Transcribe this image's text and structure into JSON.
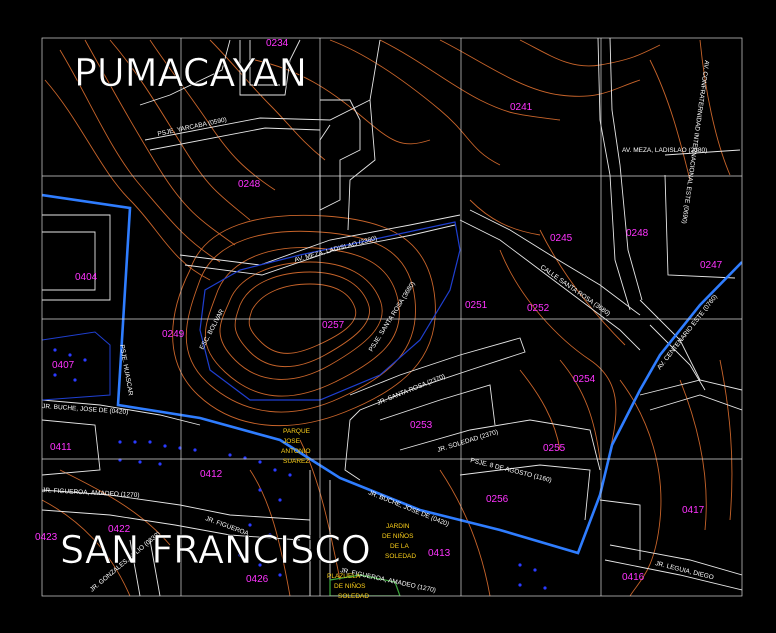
{
  "districts": {
    "north": "PUMACAYAN",
    "south": "SAN FRANCISCO"
  },
  "zones": {
    "z0234": "0234",
    "z0241": "0241",
    "z0248a": "0248",
    "z0245": "0245",
    "z0248b": "0248",
    "z0247": "0247",
    "z0404": "0404",
    "z0249": "0249",
    "z0257": "0257",
    "z0251": "0251",
    "z0252": "0252",
    "z0407": "0407",
    "z0254": "0254",
    "z0253": "0253",
    "z0411": "0411",
    "z0255": "0255",
    "z0412": "0412",
    "z0256": "0256",
    "z0417": "0417",
    "z0423": "0423",
    "z0422": "0422",
    "z0413": "0413",
    "z0426": "0426",
    "z0416": "0416"
  },
  "streets": {
    "yarcaba": "PSJE. YARCABA (0590)",
    "meza_ne": "AV. MEZA, LADISLAO (2380)",
    "confraternidad": "AV. CONFRATERNIDAD INTERNACIONAL ESTE (0690)",
    "meza_mid": "AV. MEZA, LADISLAO (2380)",
    "santa_rosa_a": "PSJE. SANTA ROSA (3680)",
    "santa_rosa_b": "JR. SANTA ROSA (2370)",
    "santa_rosa_c": "CALLE SANTA ROSA (3680)",
    "soledad": "JR. SOLEDAD (2370)",
    "ocho_agosto": "PSJE. 8 DE AGOSTO (1160)",
    "huaraz": "AV. CENTENARIO ESTE (0760)",
    "buche_w": "JR. BUCHE, JOSE DE (0420)",
    "buche_s": "JR. BUCHE, JOSE DE (0420)",
    "figueroa_w": "JR. FIGUEROA, AMADEO (1270)",
    "figueroa_s": "JR. FIGUEROA, AMADEO (1270)",
    "figueroa_mid": "JR. FIGUEROA",
    "pjes": "PSJE. HUASCAR",
    "gonzales": "JR. GONZALES, JULIO (0830)",
    "leguia": "JR. LEGUIA, DIEGO",
    "escalinata": "ESC. BOLIVAR"
  },
  "parks": {
    "parque_line1": "PARQUE",
    "parque_line2": "JOSE",
    "parque_line3": "ANTONIO",
    "parque_line4": "SUAREZ",
    "jardin_line1": "JARDIN",
    "jardin_line2": "DE NIÑOS",
    "jardin_line3": "DE LA",
    "jardin_line4": "SOLEDAD",
    "plaza_line1": "PLAZUELA",
    "plaza_line2": "DE NIÑOS",
    "plaza_line3": "SOLEDAD"
  },
  "colors": {
    "background": "#000000",
    "contour": "#c8642a",
    "boundary": "#2f7dff",
    "grid": "#d9d9d9",
    "zone_label": "#ff33ff",
    "park_label": "#ffd21a",
    "buildings": "#ffffff"
  }
}
